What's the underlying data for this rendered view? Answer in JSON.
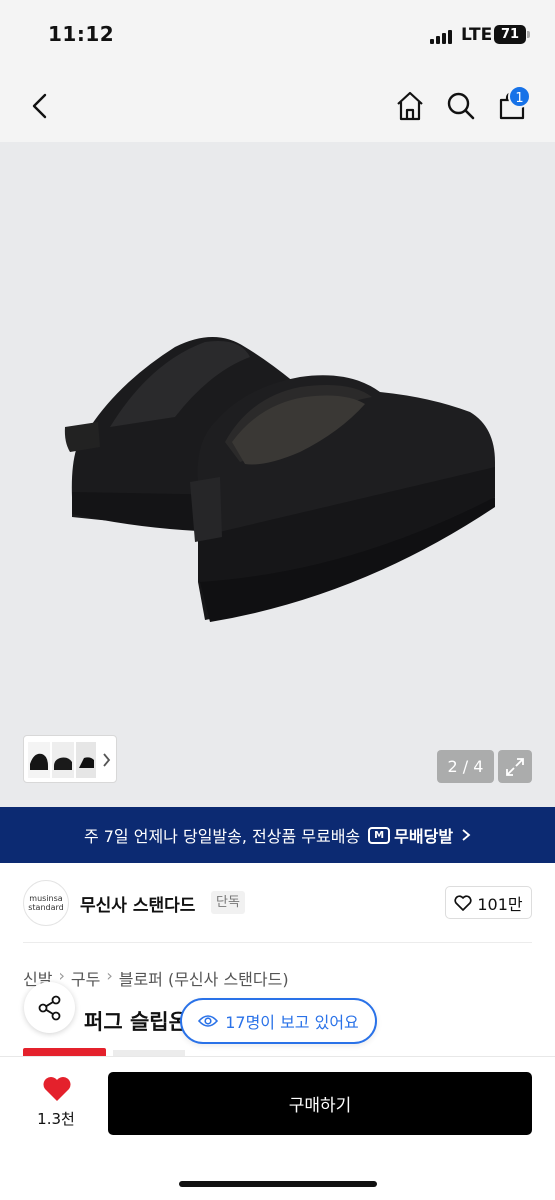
{
  "status_bar": {
    "time": "11:12",
    "network": "LTE",
    "battery": "71"
  },
  "nav": {
    "cart_count": "1",
    "icons": [
      "back-icon",
      "home-icon",
      "search-icon",
      "cart-icon"
    ]
  },
  "gallery": {
    "counter": "2 / 4"
  },
  "banner": {
    "text": "주 7일 언제나 당일발송, 전상품 무료배송",
    "logo_mark": "M",
    "logo_text": "무배당발"
  },
  "brand": {
    "logo_line1": "musinsa",
    "logo_line2": "standard",
    "name": "무신사 스탠다드",
    "tag": "단독",
    "likes": "101만"
  },
  "breadcrumb": [
    "신발",
    "구두",
    "블로퍼 (무신사 스탠다드)"
  ],
  "product": {
    "title": "퍼그 슬립온"
  },
  "viewers": {
    "text": "17명이 보고 있어요"
  },
  "bottom_bar": {
    "like_count": "1.3천",
    "buy_label": "구매하기"
  },
  "colors": {
    "accent": "#1672e8",
    "banner_bg": "#0c2a72",
    "like_red": "#e4212c"
  }
}
